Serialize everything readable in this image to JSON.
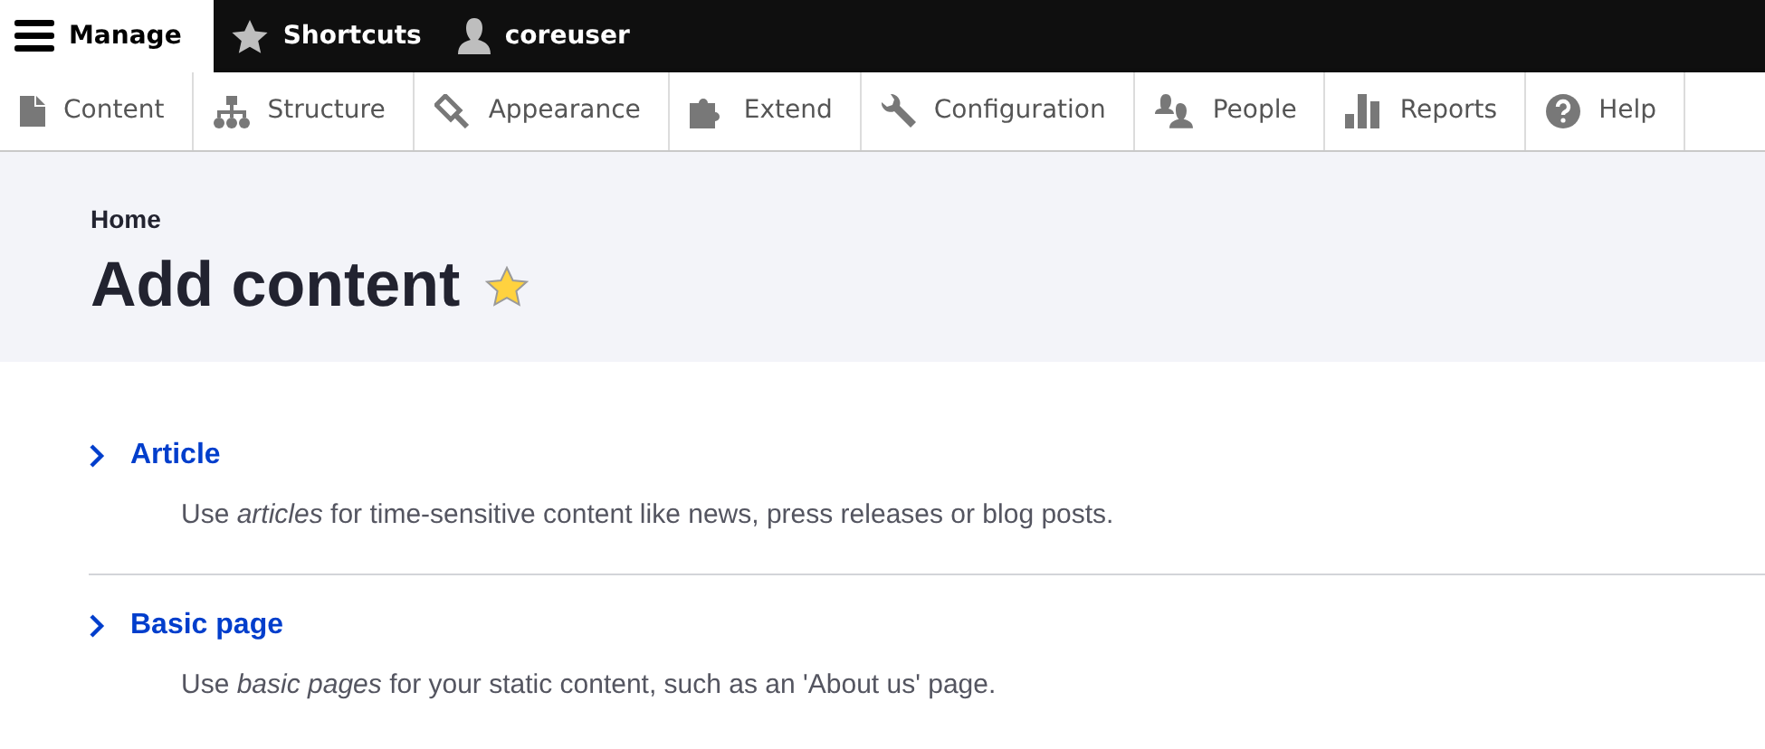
{
  "toolbar": {
    "items": [
      {
        "label": "Manage",
        "selected": true
      },
      {
        "label": "Shortcuts",
        "selected": false
      },
      {
        "label": "coreuser",
        "selected": false
      }
    ]
  },
  "tray": {
    "items": [
      {
        "label": "Content"
      },
      {
        "label": "Structure"
      },
      {
        "label": "Appearance"
      },
      {
        "label": "Extend"
      },
      {
        "label": "Configuration"
      },
      {
        "label": "People"
      },
      {
        "label": "Reports"
      },
      {
        "label": "Help"
      }
    ]
  },
  "breadcrumb": "Home",
  "page_title": "Add content",
  "shortcut_starred": true,
  "content_types": [
    {
      "title": "Article",
      "description": "Use *articles* for time-sensitive content like news, press releases or blog posts."
    },
    {
      "title": "Basic page",
      "description": "Use *basic pages* for your static content, such as an 'About us' page."
    }
  ]
}
